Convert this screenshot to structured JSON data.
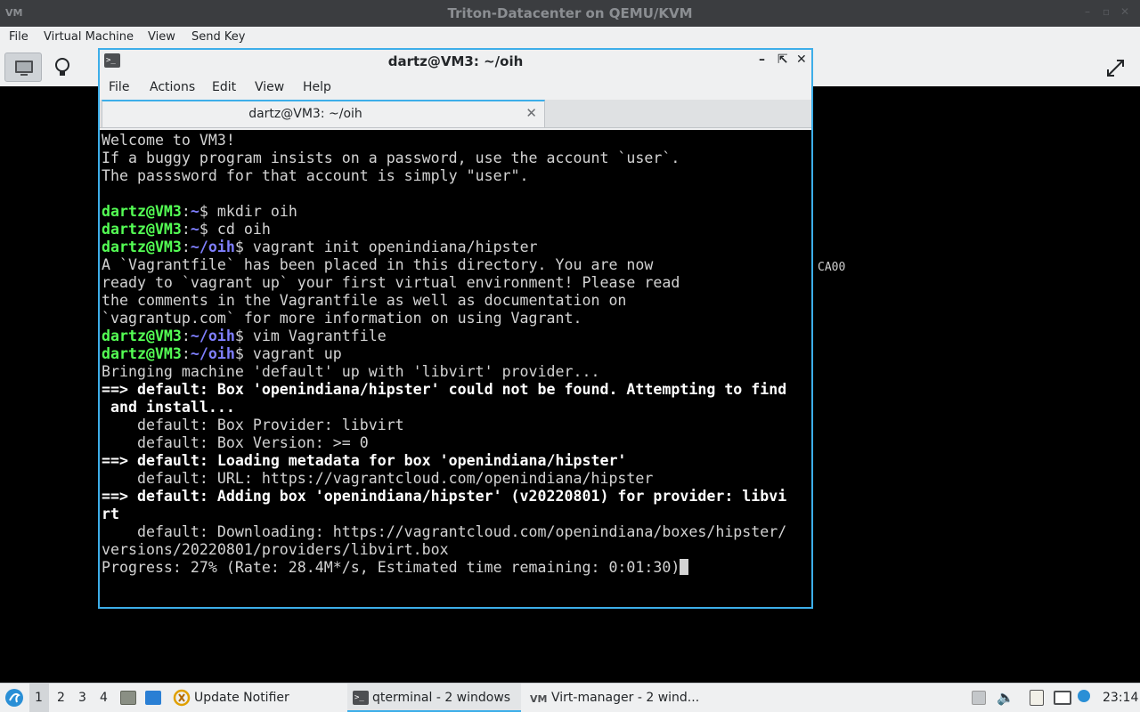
{
  "outer_window": {
    "title": "Triton-Datacenter on QEMU/KVM",
    "app_icon": "VM",
    "menu": [
      "File",
      "Virtual Machine",
      "View",
      "Send Key"
    ]
  },
  "vm_background_text": "CA00",
  "terminal": {
    "title": "dartz@VM3: ~/oih",
    "menu": [
      "File",
      "Actions",
      "Edit",
      "View",
      "Help"
    ],
    "tab_label": "dartz@VM3: ~/oih",
    "prompt_user": "dartz@VM3",
    "lines": [
      {
        "t": "out",
        "text": "Welcome to VM3!"
      },
      {
        "t": "out",
        "text": "If a buggy program insists on a password, use the account `user`."
      },
      {
        "t": "out",
        "text": "The passsword for that account is simply \"user\"."
      },
      {
        "t": "out",
        "text": ""
      },
      {
        "t": "cmd",
        "path": "~",
        "cmd": " mkdir oih"
      },
      {
        "t": "cmd",
        "path": "~",
        "cmd": " cd oih"
      },
      {
        "t": "cmd",
        "path": "~/oih",
        "cmd": " vagrant init openindiana/hipster"
      },
      {
        "t": "out",
        "text": "A `Vagrantfile` has been placed in this directory. You are now"
      },
      {
        "t": "out",
        "text": "ready to `vagrant up` your first virtual environment! Please read"
      },
      {
        "t": "out",
        "text": "the comments in the Vagrantfile as well as documentation on"
      },
      {
        "t": "out",
        "text": "`vagrantup.com` for more information on using Vagrant."
      },
      {
        "t": "cmd",
        "path": "~/oih",
        "cmd": " vim Vagrantfile"
      },
      {
        "t": "cmd",
        "path": "~/oih",
        "cmd": " vagrant up"
      },
      {
        "t": "out",
        "text": "Bringing machine 'default' up with 'libvirt' provider..."
      },
      {
        "t": "bold",
        "text": "==> default: Box 'openindiana/hipster' could not be found. Attempting to find"
      },
      {
        "t": "bold",
        "text": " and install..."
      },
      {
        "t": "out",
        "text": "    default: Box Provider: libvirt"
      },
      {
        "t": "out",
        "text": "    default: Box Version: >= 0"
      },
      {
        "t": "bold",
        "text": "==> default: Loading metadata for box 'openindiana/hipster'"
      },
      {
        "t": "out",
        "text": "    default: URL: https://vagrantcloud.com/openindiana/hipster"
      },
      {
        "t": "bold",
        "text": "==> default: Adding box 'openindiana/hipster' (v20220801) for provider: libvi"
      },
      {
        "t": "bold",
        "text": "rt"
      },
      {
        "t": "out",
        "text": "    default: Downloading: https://vagrantcloud.com/openindiana/boxes/hipster/"
      },
      {
        "t": "out",
        "text": "versions/20220801/providers/libvirt.box"
      },
      {
        "t": "progress",
        "text": "Progress: 27% (Rate: 28.4M*/s, Estimated time remaining: 0:01:30)"
      }
    ]
  },
  "taskbar": {
    "workspaces": [
      "1",
      "2",
      "3",
      "4"
    ],
    "tasks": [
      {
        "label": "Update Notifier"
      },
      {
        "label": "qterminal - 2 windows"
      },
      {
        "label": "Virt-manager - 2 wind..."
      }
    ],
    "clock": "23:14"
  },
  "colors": {
    "accent": "#3daee9",
    "prompt_user": "#54ff54",
    "prompt_path": "#7f7fff"
  }
}
